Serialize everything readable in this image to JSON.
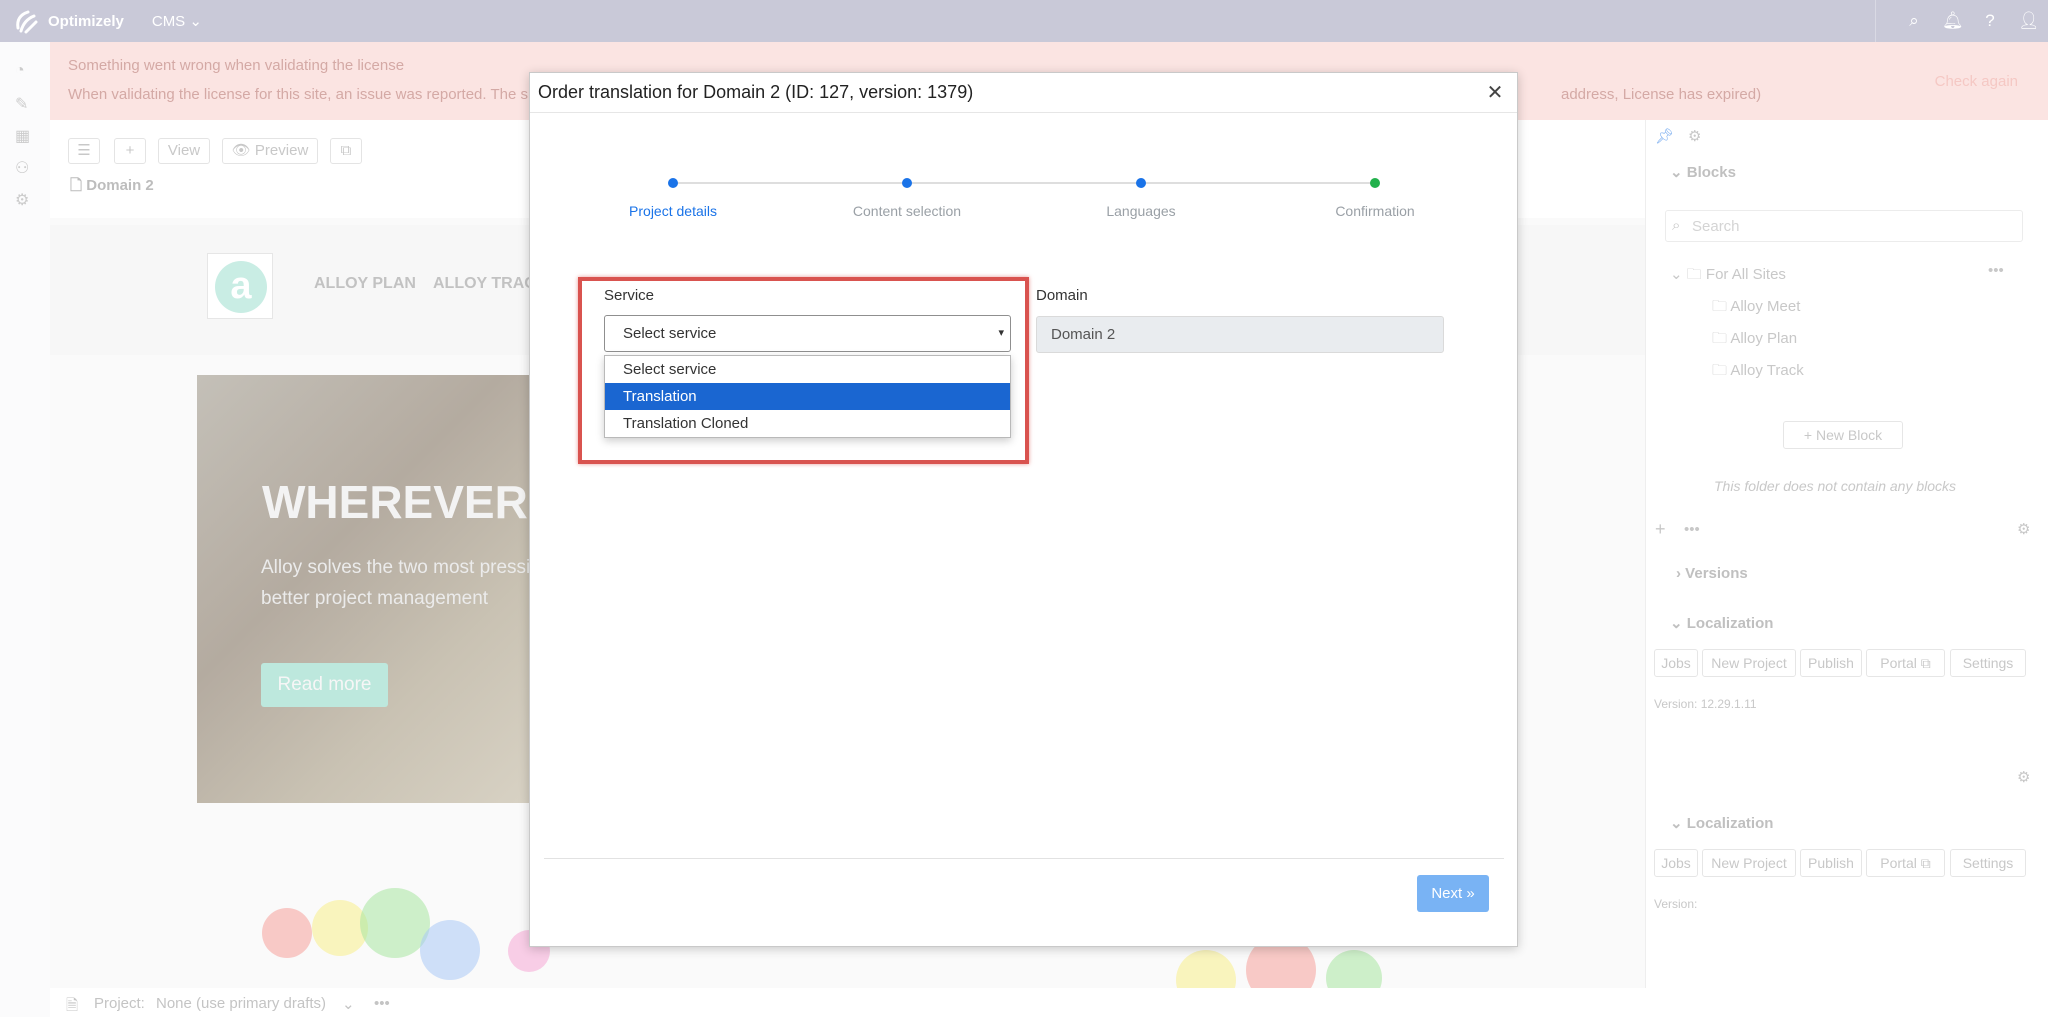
{
  "topbar": {
    "brand": "Optimizely",
    "product": "CMS",
    "product_chevron": "chevron-down-icon",
    "icons": [
      "search-icon",
      "bell-icon",
      "help-icon",
      "user-icon"
    ]
  },
  "license_warning": {
    "title": "Something went wrong when validating the license",
    "message": "When validating the license for this site, an issue was reported. The s",
    "message_tail": "address, License has expired)",
    "action": "Check again"
  },
  "editor_toolbar": {
    "view_label": "View",
    "preview_label": "Preview",
    "breadcrumb": "Domain 2"
  },
  "site_preview": {
    "nav": [
      "ALLOY PLAN",
      "ALLOY TRAC"
    ],
    "hero_title": "WHEREVER",
    "hero_text_1": "Alloy solves the two most pressi",
    "hero_text_2": "better project management",
    "read_more": "Read more"
  },
  "right_panel": {
    "blocks_title": "Blocks",
    "search_placeholder": "Search",
    "folder_root": "For All Sites",
    "folders": [
      "Alloy Meet",
      "Alloy Plan",
      "Alloy Track"
    ],
    "new_block": "New Block",
    "empty_text": "This folder does not contain any blocks",
    "versions_title": "Versions",
    "localization_title": "Localization",
    "loc_buttons": [
      "Jobs",
      "New Project",
      "Publish",
      "Portal",
      "Settings"
    ],
    "version_text": "Version: 12.29.1.11",
    "localization_title_2": "Localization",
    "version_text_2": "Version:"
  },
  "bottombar": {
    "project_label": "Project:",
    "project_value": "None (use primary drafts)"
  },
  "modal": {
    "title": "Order translation for Domain 2 (ID: 127, version: 1379)",
    "steps": [
      {
        "label": "Project details",
        "status": "active",
        "color": "#1a73e8"
      },
      {
        "label": "Content selection",
        "status": "pending",
        "color": "#1a73e8"
      },
      {
        "label": "Languages",
        "status": "pending",
        "color": "#1a73e8"
      },
      {
        "label": "Confirmation",
        "status": "pending",
        "color": "#22b14c"
      }
    ],
    "service_label": "Service",
    "service_value": "Select service",
    "service_options": [
      "Select service",
      "Translation",
      "Translation Cloned"
    ],
    "service_highlighted_option": "Translation",
    "domain_label": "Domain",
    "domain_value": "Domain 2",
    "next_label": "Next »"
  },
  "colors": {
    "accent": "#1a73e8",
    "highlight_border": "#d9534f",
    "dropdown_selected": "#1a66d1",
    "confirmation_dot": "#22b14c",
    "next_button": "#79b3f4"
  }
}
